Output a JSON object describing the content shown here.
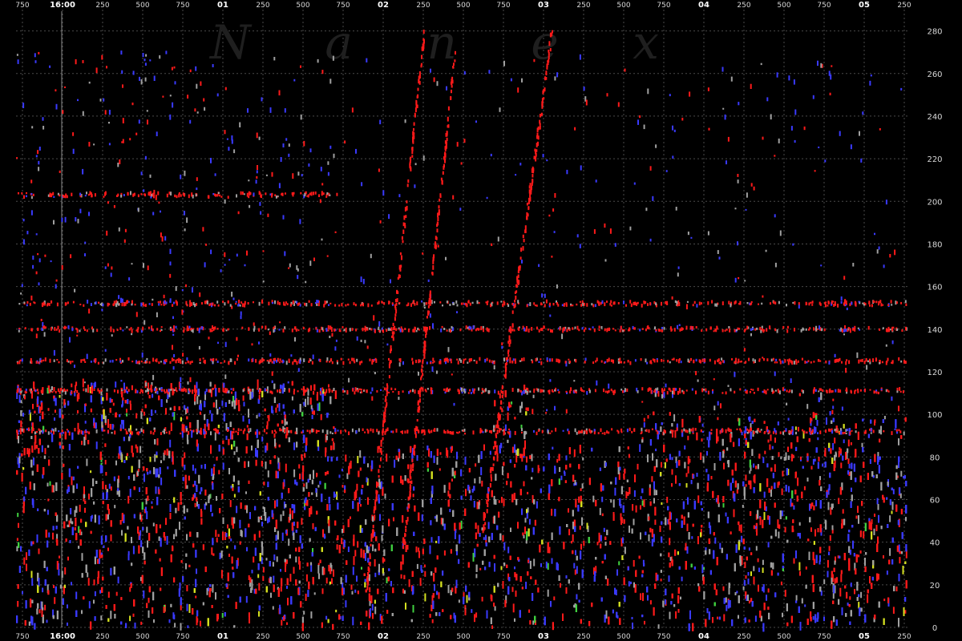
{
  "chart_data": {
    "type": "scatter",
    "title": "",
    "xlabel": "",
    "ylabel": "",
    "watermark": "Nanex",
    "x_tick_labels": [
      "750",
      "16:00",
      "250",
      "500",
      "750",
      "01",
      "250",
      "500",
      "750",
      "02",
      "250",
      "500",
      "750",
      "03",
      "250",
      "500",
      "750",
      "04",
      "250",
      "500",
      "750",
      "05",
      "250"
    ],
    "x_major_labels": [
      "16:00",
      "01",
      "02",
      "03",
      "04",
      "05"
    ],
    "y_ticks": [
      0,
      20,
      40,
      60,
      80,
      100,
      120,
      140,
      160,
      180,
      200,
      220,
      240,
      260,
      280
    ],
    "ylim": [
      0,
      290
    ],
    "grid": true,
    "colors": {
      "background": "#000000",
      "red": "#ff1a1a",
      "blue": "#3a3aff",
      "gray": "#a0a0a0",
      "yellow": "#d4e020",
      "green": "#40d040",
      "pink": "#ff80a0"
    },
    "bands": [
      {
        "y": 203,
        "color": "red"
      },
      {
        "y": 152,
        "color": "red"
      },
      {
        "y": 140,
        "color": "red"
      },
      {
        "y": 125,
        "color": "red"
      },
      {
        "y": 111,
        "color": "red"
      },
      {
        "y": 92,
        "color": "red"
      }
    ]
  }
}
